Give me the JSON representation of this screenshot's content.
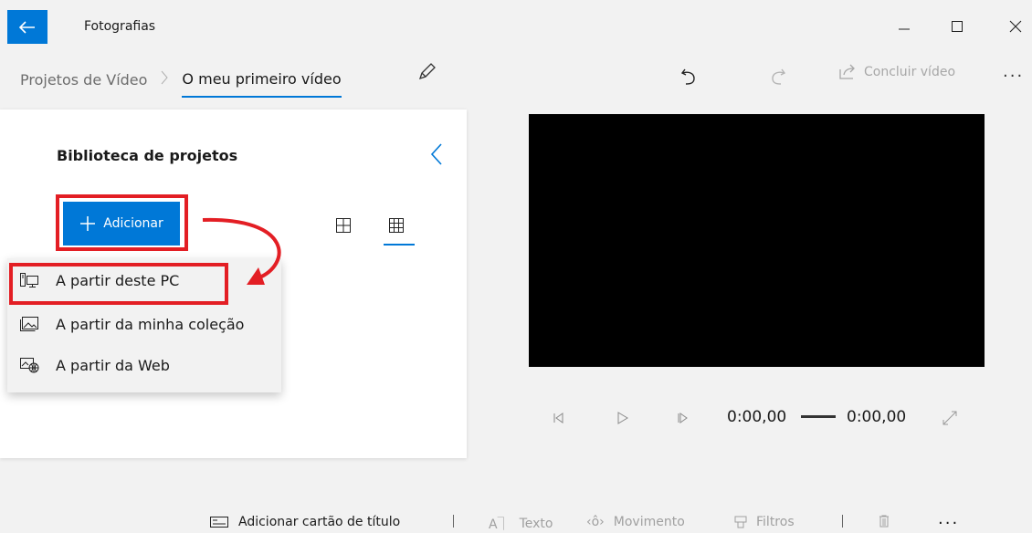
{
  "window": {
    "title": "Fotografias",
    "back_icon": "back-arrow-icon",
    "controls": [
      "minimize-icon",
      "maximize-icon",
      "close-icon"
    ]
  },
  "breadcrumb": {
    "root": "Projetos de Vídeo",
    "current": "O meu primeiro vídeo"
  },
  "top_toolbar": {
    "undo_icon": "undo-icon",
    "redo_icon": "redo-icon",
    "finish_label": "Concluir vídeo",
    "more": "..."
  },
  "library": {
    "title": "Biblioteca de projetos",
    "add_label": "Adicionar",
    "add_menu": [
      {
        "label": "A partir deste PC",
        "icon": "pc-icon"
      },
      {
        "label": "A partir da minha coleção",
        "icon": "collection-icon"
      },
      {
        "label": "A partir da Web",
        "icon": "web-image-icon"
      }
    ]
  },
  "player": {
    "time_current": "0:00,00",
    "time_total": "0:00,00"
  },
  "bottom_toolbar": {
    "title_card": "Adicionar cartão de título",
    "text": "Texto",
    "motion": "Movimento",
    "filters": "Filtros",
    "more": "..."
  },
  "colors": {
    "accent": "#0078d7",
    "highlight": "#e31e24"
  }
}
